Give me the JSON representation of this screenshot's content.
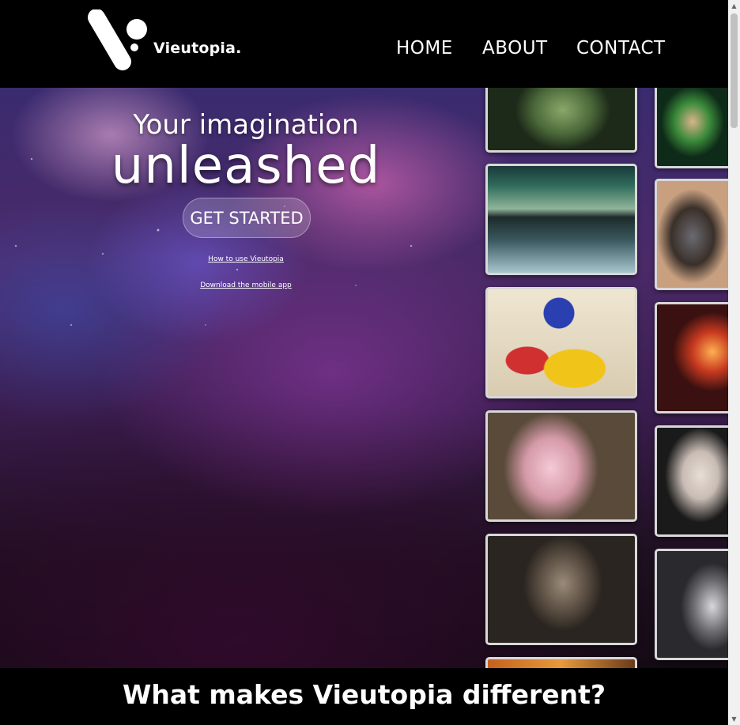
{
  "brand": {
    "name": "Vieutopia."
  },
  "nav": {
    "home": "HOME",
    "about": "ABOUT",
    "contact": "CONTACT"
  },
  "hero": {
    "title_small": "Your imagination",
    "title_big": "unleashed",
    "cta_label": "GET STARTED",
    "link_how": "How to use Vieutopia",
    "link_download": "Download the mobile app"
  },
  "gallery": {
    "column1": [
      "green-giant-face",
      "aurora-lake-landscape",
      "abstract-miro-style-painting",
      "pink-squirrel-with-brush",
      "man-in-hat-portrait",
      "orange-painting-partial"
    ],
    "column2": [
      "green-masked-hero",
      "armored-robot-figure",
      "fiery-explosion",
      "girl-with-wine-glass",
      "white-haired-creature"
    ]
  },
  "section": {
    "heading": "What makes Vieutopia different?"
  },
  "colors": {
    "background": "#000000",
    "text": "#ffffff",
    "card_border": "#d8d8d8"
  }
}
